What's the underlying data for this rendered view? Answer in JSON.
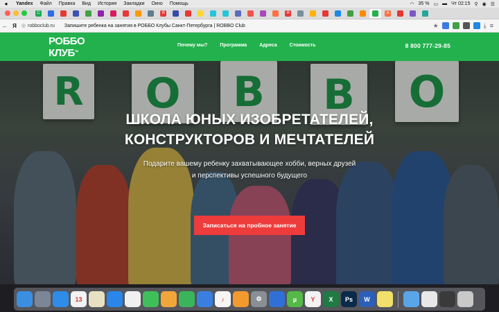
{
  "menubar": {
    "app": "Yandex",
    "items": [
      "Файл",
      "Правка",
      "Вид",
      "История",
      "Закладки",
      "Окно",
      "Помощь"
    ],
    "battery": "35 %",
    "clock": "Чт 02:15"
  },
  "tabs": {
    "traffic_colors": [
      "#fe5f57",
      "#febc2e",
      "#28c840"
    ],
    "items": [
      {
        "color": "#1aaa55",
        "glyph": "C"
      },
      {
        "color": "#2b6ee8",
        "glyph": ""
      },
      {
        "color": "#e53935",
        "glyph": ""
      },
      {
        "color": "#3f51b5",
        "glyph": ""
      },
      {
        "color": "#43a047",
        "glyph": ""
      },
      {
        "color": "#8e24aa",
        "glyph": ""
      },
      {
        "color": "#d81b60",
        "glyph": ""
      },
      {
        "color": "#e53935",
        "glyph": ""
      },
      {
        "color": "#ff9800",
        "glyph": ""
      },
      {
        "color": "#607d8b",
        "glyph": ""
      },
      {
        "color": "#e53935",
        "glyph": "Я"
      },
      {
        "color": "#3949ab",
        "glyph": ""
      },
      {
        "color": "#e53935",
        "glyph": ""
      },
      {
        "color": "#fdd835",
        "glyph": ""
      },
      {
        "color": "#26c6da",
        "glyph": ""
      },
      {
        "color": "#26c6da",
        "glyph": ""
      },
      {
        "color": "#5c6bc0",
        "glyph": ""
      },
      {
        "color": "#ef5350",
        "glyph": ""
      },
      {
        "color": "#ab47bc",
        "glyph": ""
      },
      {
        "color": "#ff7043",
        "glyph": ""
      },
      {
        "color": "#e53935",
        "glyph": "Я"
      },
      {
        "color": "#78909c",
        "glyph": ""
      },
      {
        "color": "#ffb300",
        "glyph": ""
      },
      {
        "color": "#e53935",
        "glyph": ""
      },
      {
        "color": "#1e88e5",
        "glyph": ""
      },
      {
        "color": "#43a047",
        "glyph": ""
      },
      {
        "color": "#fb8c00",
        "glyph": ""
      },
      {
        "color": "#23b14d",
        "glyph": "",
        "active": true
      },
      {
        "color": "#ff7043",
        "glyph": "A"
      },
      {
        "color": "#e53935",
        "glyph": ""
      },
      {
        "color": "#7e57c2",
        "glyph": ""
      },
      {
        "color": "#26a69a",
        "glyph": ""
      }
    ]
  },
  "address_bar": {
    "domain": "robboclub.ru",
    "page_title": "Запишите ребенка на занятия в РОББО Клубы Санкт-Петербурга | ROBBO Club"
  },
  "site": {
    "logo_line1": "РОББО",
    "logo_line2": "КЛУБ",
    "logo_tm": "TM",
    "nav": [
      "Почему мы?",
      "Программа",
      "Адреса",
      "Стоимость"
    ],
    "phone": "8 800 777-29-85"
  },
  "hero": {
    "board_letters": [
      "R",
      "O",
      "B",
      "B",
      "O"
    ],
    "headline_line1": "ШКОЛА ЮНЫХ ИЗОБРЕТАТЕЛЕЙ,",
    "headline_line2": "КОНСТРУКТОРОВ И МЕЧТАТЕЛЕЙ",
    "sub_line1": "Подарите вашему ребенку захватывающее хобби, верных друзей",
    "sub_line2": "и перспективы успешного будущего",
    "cta": "Записаться на пробное занятие",
    "colors": {
      "cta": "#ee3b3b",
      "brand_green": "#23b14d",
      "letter_green": "#1c9b4a"
    }
  },
  "dock": {
    "apps": [
      {
        "name": "finder",
        "color": "#3b8fe0",
        "glyph": ""
      },
      {
        "name": "launchpad",
        "color": "#7b8796",
        "glyph": ""
      },
      {
        "name": "safari",
        "color": "#2f8ce8",
        "glyph": ""
      },
      {
        "name": "calendar",
        "color": "#f2f2f2",
        "glyph": "13"
      },
      {
        "name": "notes",
        "color": "#e8e0c2",
        "glyph": ""
      },
      {
        "name": "app-store",
        "color": "#2a86e8",
        "glyph": ""
      },
      {
        "name": "photos",
        "color": "#f0f0f0",
        "glyph": ""
      },
      {
        "name": "messages",
        "color": "#3fbf5a",
        "glyph": ""
      },
      {
        "name": "pages",
        "color": "#f0a63a",
        "glyph": ""
      },
      {
        "name": "numbers",
        "color": "#3bb55c",
        "glyph": ""
      },
      {
        "name": "keynote",
        "color": "#3a7fe0",
        "glyph": ""
      },
      {
        "name": "music",
        "color": "#f5f5f5",
        "glyph": "♪"
      },
      {
        "name": "books",
        "color": "#f29a2e",
        "glyph": ""
      },
      {
        "name": "system-preferences",
        "color": "#8a8f96",
        "glyph": "⚙"
      },
      {
        "name": "editor",
        "color": "#2f6fd6",
        "glyph": ""
      },
      {
        "name": "utorrent",
        "color": "#55b947",
        "glyph": "µ"
      },
      {
        "name": "yandex-browser",
        "color": "#f2f2f2",
        "glyph": "Y"
      },
      {
        "name": "excel",
        "color": "#1f7a43",
        "glyph": "X"
      },
      {
        "name": "photoshop",
        "color": "#0b2a4a",
        "glyph": "Ps"
      },
      {
        "name": "word",
        "color": "#2b5fb8",
        "glyph": "W"
      },
      {
        "name": "stickies",
        "color": "#f1e06a",
        "glyph": ""
      },
      {
        "name": "folder-downloads",
        "color": "#5aa5e8",
        "glyph": ""
      },
      {
        "name": "preview",
        "color": "#e8e8e8",
        "glyph": ""
      },
      {
        "name": "screenshot",
        "color": "#3a3a3a",
        "glyph": ""
      },
      {
        "name": "trash",
        "color": "#c9c9c9",
        "glyph": ""
      }
    ]
  }
}
